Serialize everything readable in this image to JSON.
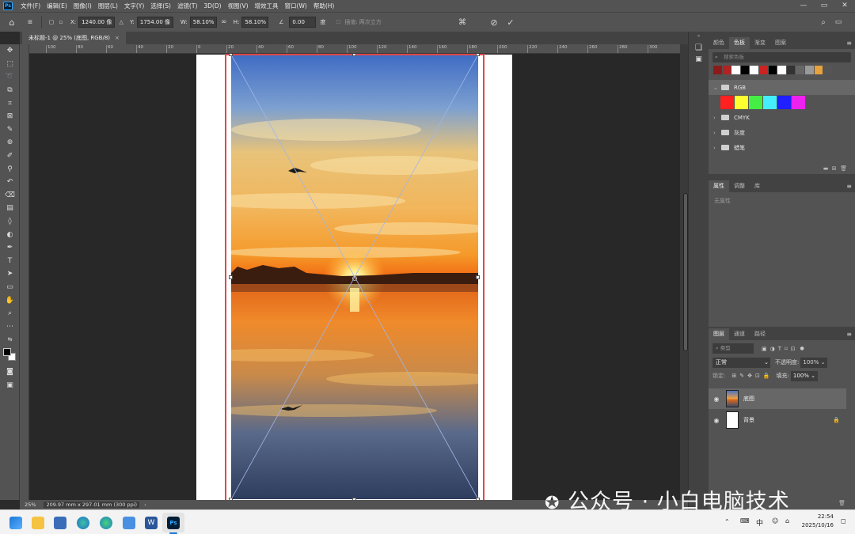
{
  "menu": {
    "app_icon": "Ps",
    "items": [
      "文件(F)",
      "编辑(E)",
      "图像(I)",
      "图层(L)",
      "文字(Y)",
      "选择(S)",
      "滤镜(T)",
      "3D(D)",
      "视图(V)",
      "增效工具",
      "窗口(W)",
      "帮助(H)"
    ],
    "window_controls": [
      "—",
      "▭",
      "✕"
    ]
  },
  "options": {
    "x_label": "X:",
    "x_value": "1240.00 像",
    "y_label": "Y:",
    "y_value": "1754.00 像",
    "w_label": "W:",
    "w_value": "58.10%",
    "h_label": "H:",
    "h_value": "58.10%",
    "angle_value": "0.00",
    "angle_unit": "度",
    "interp_label": "插值:",
    "interp_value": "两次立方"
  },
  "tab": {
    "title": "未标题-1 @ 25% (底图, RGB/8)",
    "close": "×"
  },
  "ruler_top": [
    "100",
    "80",
    "60",
    "40",
    "20",
    "0",
    "20",
    "40",
    "60",
    "80",
    "100",
    "120",
    "140",
    "160",
    "180",
    "200",
    "220",
    "240",
    "260",
    "280",
    "300"
  ],
  "status": {
    "zoom": "25%",
    "doc_info": "209.97 mm x 297.01 mm (300 ppi)"
  },
  "swatches_panel": {
    "tabs": [
      "颜色",
      "色板",
      "渐变",
      "图案"
    ],
    "active_tab": "色板",
    "search_placeholder": "搜索色板",
    "recent": [
      "#8b1a1a",
      "#b22222",
      "#ffffff",
      "#000000",
      "#ffffff",
      "#cc2222",
      "#000000",
      "#ffffff",
      "#333333",
      "#666666",
      "#999999",
      "#e6a23c",
      "#555555"
    ],
    "groups": [
      {
        "name": "RGB",
        "expanded": true,
        "colors": [
          "#ff2020",
          "#ffff30",
          "#44ee44",
          "#44eeff",
          "#1f1fff",
          "#ee22ee"
        ]
      },
      {
        "name": "CMYK",
        "expanded": false
      },
      {
        "name": "灰度",
        "expanded": false
      },
      {
        "name": "蜡笔",
        "expanded": false
      }
    ]
  },
  "properties_panel": {
    "tabs": [
      "属性",
      "调整",
      "库"
    ],
    "active_tab": "属性",
    "empty_text": "无属性"
  },
  "layers_panel": {
    "tabs": [
      "图层",
      "通道",
      "路径"
    ],
    "active_tab": "图层",
    "filter_label": "类型",
    "blend_mode": "正常",
    "opacity_label": "不透明度:",
    "opacity_value": "100%",
    "lock_label": "锁定:",
    "fill_label": "填充:",
    "fill_value": "100%",
    "layers": [
      {
        "name": "底图",
        "selected": true
      },
      {
        "name": "背景",
        "selected": false,
        "locked": true
      }
    ]
  },
  "taskbar": {
    "time": "22:54",
    "date": "2025/10/16",
    "ime": "中"
  },
  "watermark": "公众号 · 小白电脑技术"
}
